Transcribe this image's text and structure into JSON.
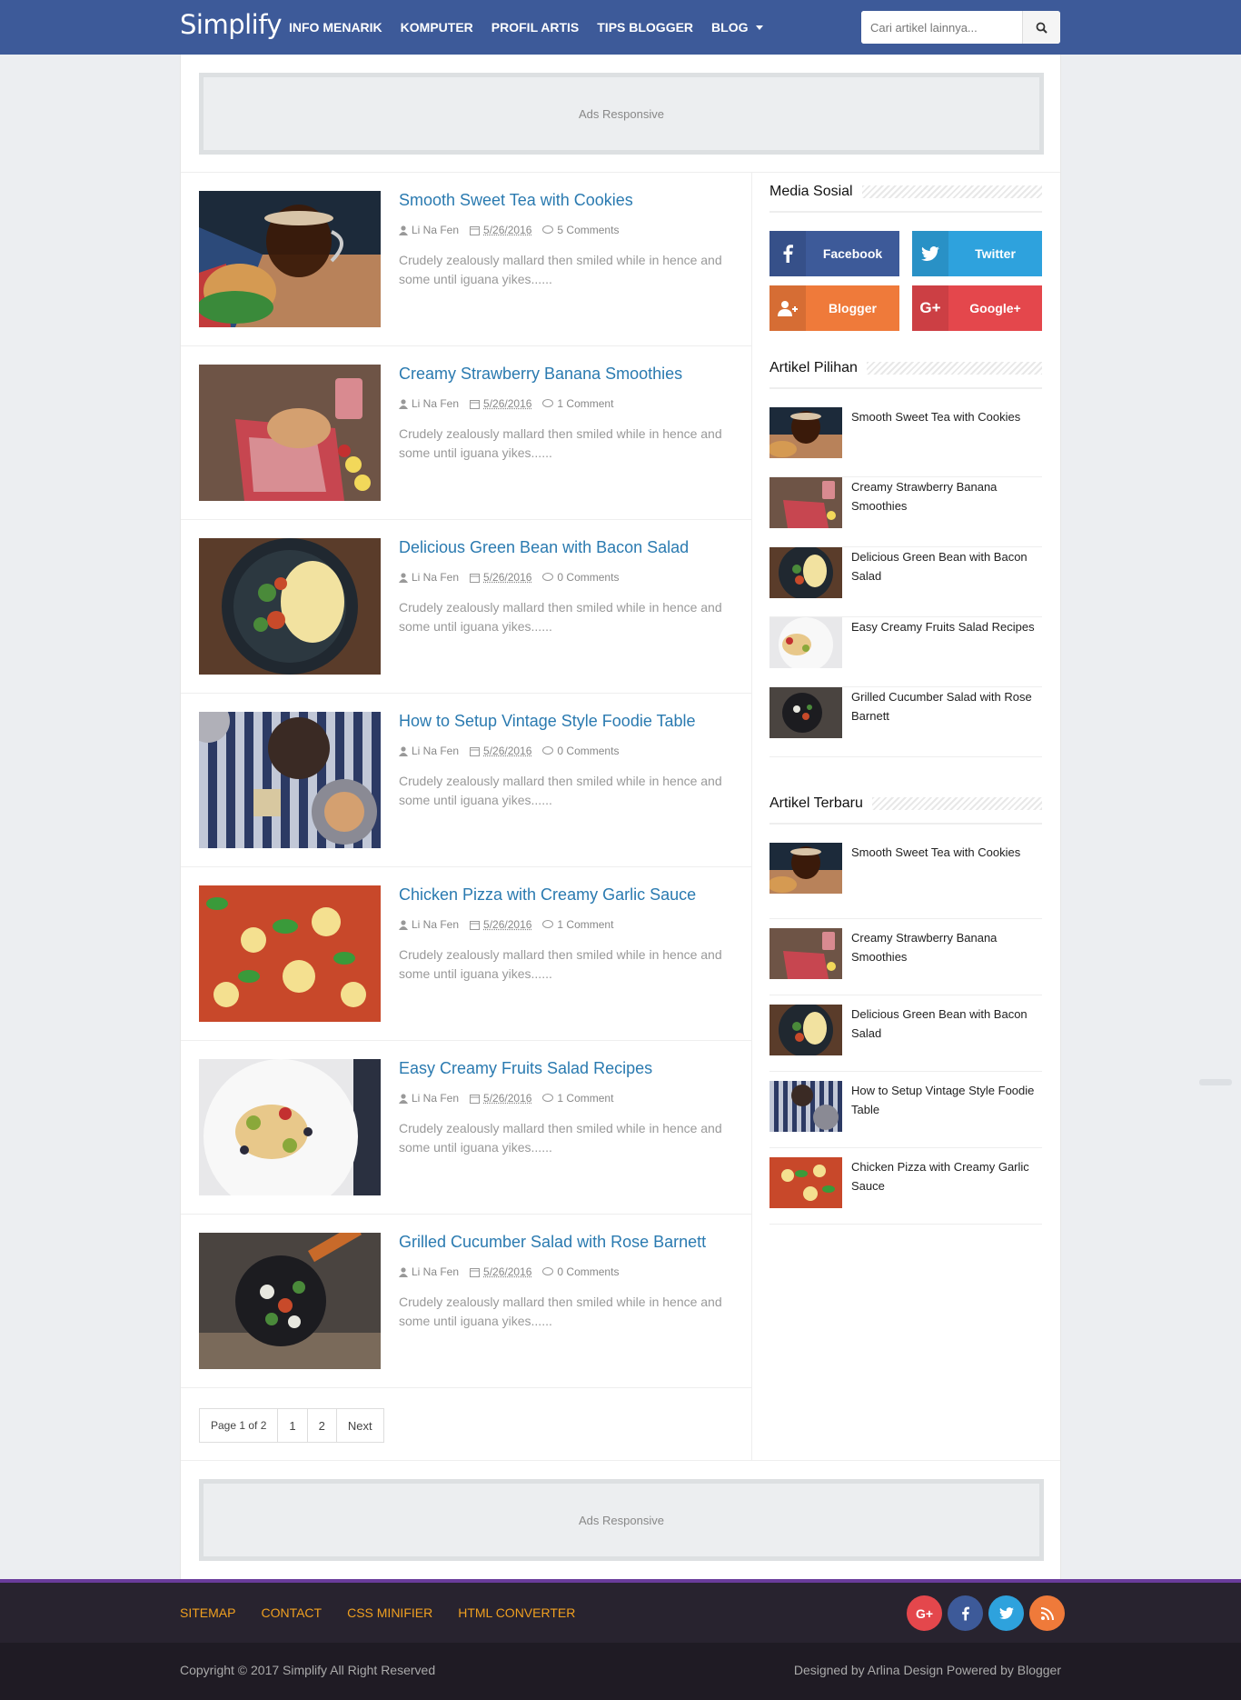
{
  "header": {
    "brand": "Simplify",
    "nav": [
      "INFO MENARIK",
      "KOMPUTER",
      "PROFIL ARTIS",
      "TIPS BLOGGER",
      "BLOG"
    ],
    "search_placeholder": "Cari artikel lainnya..."
  },
  "ads": {
    "top": "Ads Responsive",
    "bottom": "Ads Responsive"
  },
  "posts": [
    {
      "title": "Smooth Sweet Tea with Cookies",
      "author": "Li Na Fen",
      "date": "5/26/2016",
      "comments": "5 Comments",
      "excerpt": "Crudely zealously mallard then smiled while in hence and some until iguana yikes......"
    },
    {
      "title": "Creamy Strawberry Banana Smoothies",
      "author": "Li Na Fen",
      "date": "5/26/2016",
      "comments": "1 Comment",
      "excerpt": "Crudely zealously mallard then smiled while in hence and some until iguana yikes......"
    },
    {
      "title": "Delicious Green Bean with Bacon Salad",
      "author": "Li Na Fen",
      "date": "5/26/2016",
      "comments": "0 Comments",
      "excerpt": "Crudely zealously mallard then smiled while in hence and some until iguana yikes......"
    },
    {
      "title": "How to Setup Vintage Style Foodie Table",
      "author": "Li Na Fen",
      "date": "5/26/2016",
      "comments": "0 Comments",
      "excerpt": "Crudely zealously mallard then smiled while in hence and some until iguana yikes......"
    },
    {
      "title": "Chicken Pizza with Creamy Garlic Sauce",
      "author": "Li Na Fen",
      "date": "5/26/2016",
      "comments": "1 Comment",
      "excerpt": "Crudely zealously mallard then smiled while in hence and some until iguana yikes......"
    },
    {
      "title": "Easy Creamy Fruits Salad Recipes",
      "author": "Li Na Fen",
      "date": "5/26/2016",
      "comments": "1 Comment",
      "excerpt": "Crudely zealously mallard then smiled while in hence and some until iguana yikes......"
    },
    {
      "title": "Grilled Cucumber Salad with Rose Barnett",
      "author": "Li Na Fen",
      "date": "5/26/2016",
      "comments": "0 Comments",
      "excerpt": "Crudely zealously mallard then smiled while in hence and some until iguana yikes......"
    }
  ],
  "pager": {
    "info": "Page 1 of 2",
    "pages": [
      "1",
      "2"
    ],
    "next": "Next"
  },
  "sidebar": {
    "social_title": "Media Sosial",
    "social": [
      {
        "label": "Facebook",
        "color": "#3d5a99",
        "icon": "facebook-icon"
      },
      {
        "label": "Twitter",
        "color": "#2ea2dd",
        "icon": "twitter-icon"
      },
      {
        "label": "Blogger",
        "color": "#ef7a3a",
        "icon": "blogger-icon"
      },
      {
        "label": "Google+",
        "color": "#e4474c",
        "icon": "google-plus-icon"
      }
    ],
    "featured_title": "Artikel Pilihan",
    "featured": [
      "Smooth Sweet Tea with Cookies",
      "Creamy Strawberry Banana Smoothies",
      "Delicious Green Bean with Bacon Salad",
      "Easy Creamy Fruits Salad Recipes",
      "Grilled Cucumber Salad with Rose Barnett"
    ],
    "recent_title": "Artikel Terbaru",
    "recent": [
      "Smooth Sweet Tea with Cookies",
      "Creamy Strawberry Banana Smoothies",
      "Delicious Green Bean with Bacon Salad",
      "How to Setup Vintage Style Foodie Table",
      "Chicken Pizza with Creamy Garlic Sauce"
    ]
  },
  "footer": {
    "links": [
      "SITEMAP",
      "CONTACT",
      "CSS MINIFIER",
      "HTML CONVERTER"
    ],
    "copyright": "Copyright © 2017 Simplify All Right Reserved",
    "credit": "Designed by Arlina Design Powered by Blogger"
  }
}
